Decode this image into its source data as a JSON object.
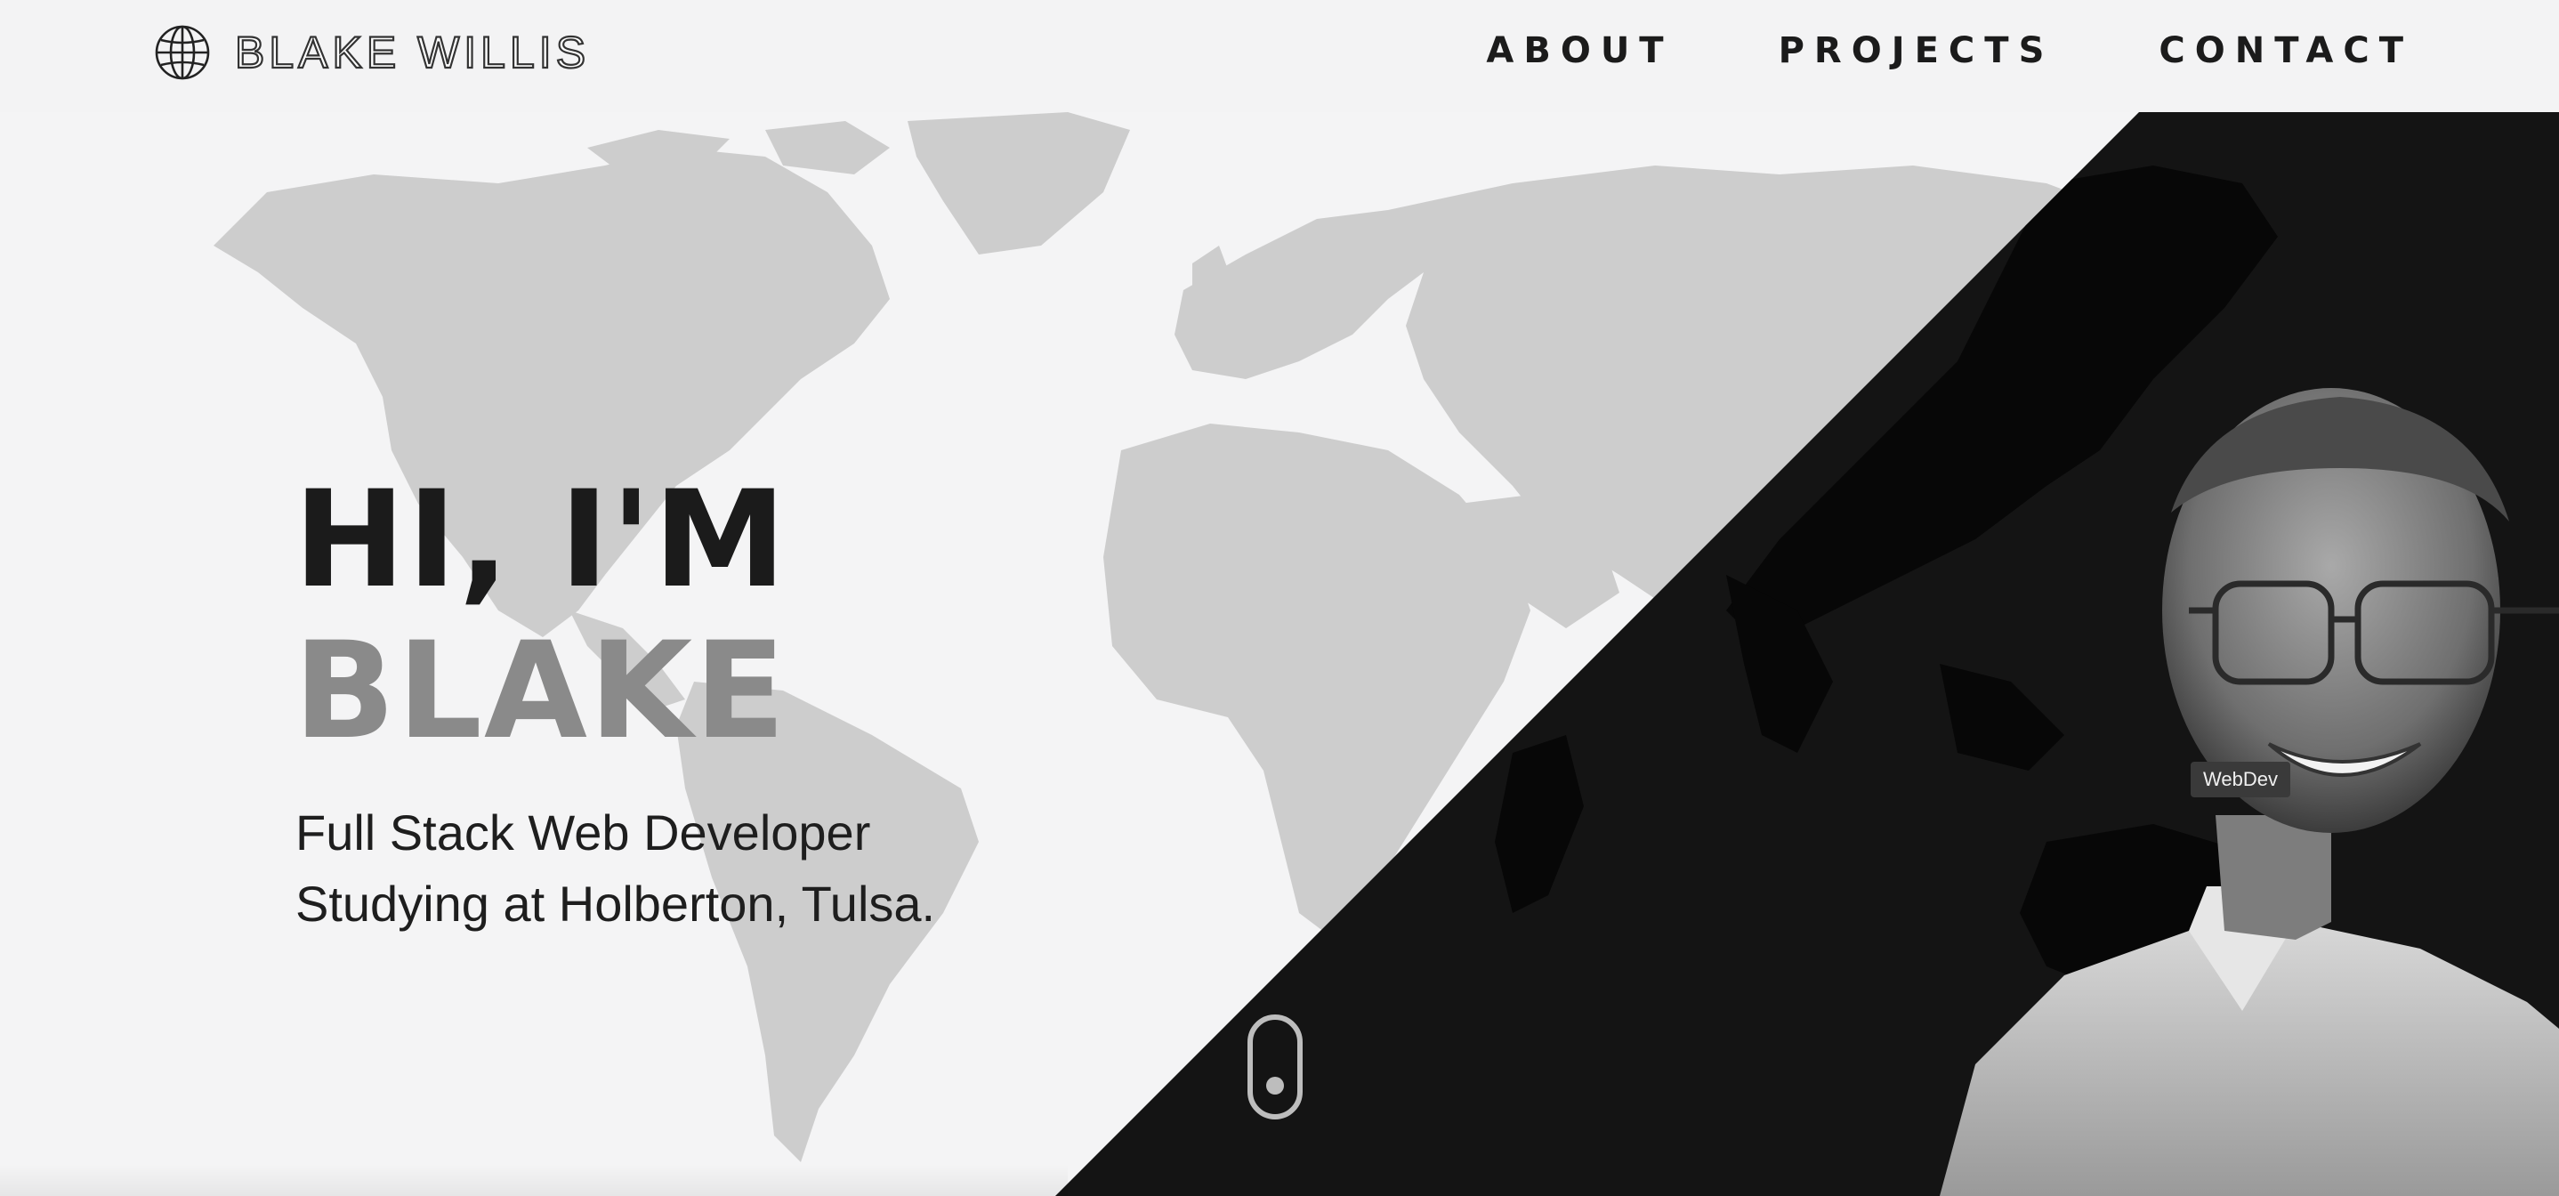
{
  "header": {
    "logo_text": "BLAKE WILLIS",
    "logo_icon": "globe-icon",
    "nav": [
      {
        "label": "ABOUT"
      },
      {
        "label": "PROJECTS"
      },
      {
        "label": "CONTACT"
      }
    ]
  },
  "hero": {
    "greeting": "HI, I'M",
    "name": "BLAKE",
    "subtitle_line1": "Full Stack Web Developer",
    "subtitle_line2": "Studying at Holberton, Tulsa.",
    "scroll_icon": "mouse-scroll-icon",
    "portrait_tag": "WebDev"
  },
  "colors": {
    "background": "#f3f3f4",
    "dark_panel": "#141414",
    "headline": "#1b1b1b",
    "name_accent": "#8a8a8a",
    "map_light": "#cfcfcf",
    "map_dark": "#0a0a0a"
  }
}
